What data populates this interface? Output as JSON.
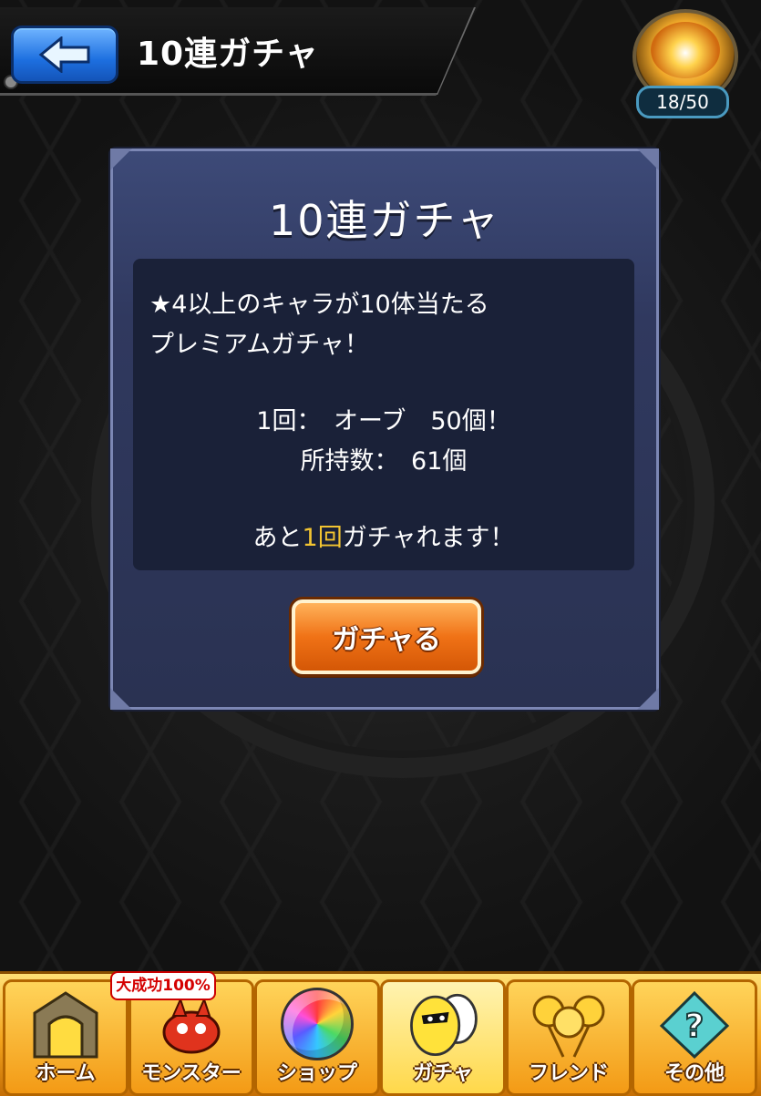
{
  "header": {
    "title": "10連ガチャ",
    "stamina": "18/50"
  },
  "dialog": {
    "title": "10連ガチャ",
    "description_line1": "★4以上のキャラが10体当たる",
    "description_line2": "プレミアムガチャ！",
    "cost_line": "1回：　オーブ　50個！",
    "owned_line": "所持数：　61個",
    "remaining_prefix": "あと",
    "remaining_count": "1回",
    "remaining_suffix": "ガチャれます！",
    "button_label": "ガチャる"
  },
  "nav": {
    "badge": "大成功100%",
    "items": [
      {
        "label": "ホーム",
        "icon": "gate-icon"
      },
      {
        "label": "モンスター",
        "icon": "dragon-icon"
      },
      {
        "label": "ショップ",
        "icon": "rainbow-orb-icon"
      },
      {
        "label": "ガチャ",
        "icon": "egg-icon"
      },
      {
        "label": "フレンド",
        "icon": "balloons-icon"
      },
      {
        "label": "その他",
        "icon": "question-icon"
      }
    ]
  },
  "colors": {
    "dialog_bg": "#30395f",
    "highlight": "#f2c431",
    "button": "#f07216",
    "nav": "#f3a31c"
  }
}
